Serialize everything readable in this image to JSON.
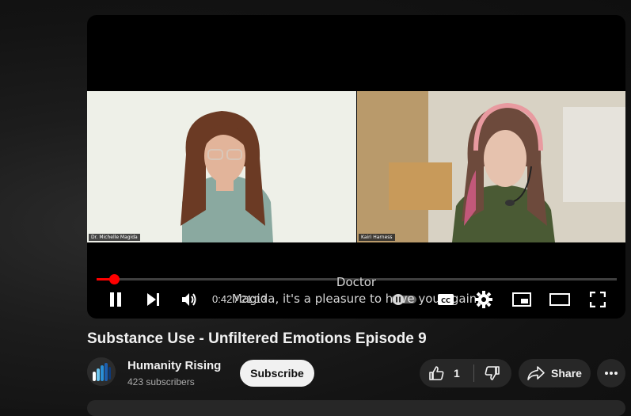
{
  "player": {
    "current_time": "0:42",
    "duration": "21:13",
    "time_display": "0:42 / 21:13",
    "progress_fraction": 0.033,
    "participants": [
      "Dr. Michelle Magida",
      "Kairi Harness"
    ],
    "captions": [
      "Doctor",
      "Magida, it's a pleasure to have you again."
    ],
    "controls": [
      "pause-icon",
      "next-icon",
      "volume-icon",
      "autoplay-toggle",
      "cc-icon",
      "settings-icon",
      "miniplayer-icon",
      "theater-icon",
      "fullscreen-icon"
    ]
  },
  "video": {
    "title": "Substance Use - Unfiltered Emotions Episode 9"
  },
  "channel": {
    "name": "Humanity Rising",
    "subscribers": "423 subscribers",
    "subscribe_label": "Subscribe"
  },
  "actions": {
    "like_count": "1",
    "share_label": "Share"
  },
  "colors": {
    "accent": "#ff0000",
    "background": "#0f0f0f",
    "pill": "#272727"
  }
}
